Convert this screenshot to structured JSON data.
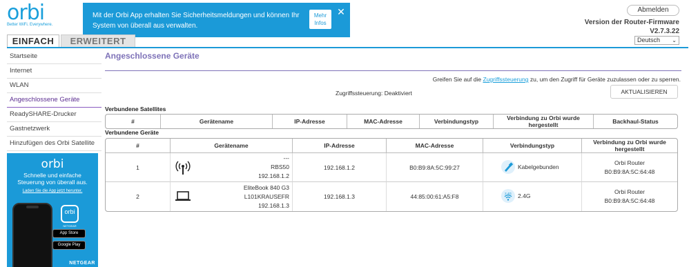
{
  "header": {
    "logo_word": "orbi",
    "logo_tagline": "Better WiFi. Everywhere.",
    "banner_text": "Mit der Orbi App erhalten Sie Sicherheitsmeldungen und können Ihr System von überall aus verwalten.",
    "banner_more_label_1": "Mehr",
    "banner_more_label_2": "Infos",
    "banner_close": "✕",
    "tab_simple": "EINFACH",
    "tab_advanced": "ERWEITERT",
    "logout_label": "Abmelden",
    "firmware_label": "Version der Router-Firmware",
    "firmware_version": "V2.7.3.22",
    "language": "Deutsch",
    "language_arrow": "⌄",
    "accent_color": "#1b9ad8"
  },
  "sidebar": {
    "items": [
      {
        "label": "Startseite"
      },
      {
        "label": "Internet"
      },
      {
        "label": "WLAN"
      },
      {
        "label": "Angeschlossene Geräte",
        "active": true
      },
      {
        "label": "ReadySHARE-Drucker"
      },
      {
        "label": "Gastnetzwerk"
      },
      {
        "label": "Hinzufügen des Orbi Satellite"
      }
    ],
    "promo": {
      "logo": "orbi",
      "text": "Schnelle und einfache Steuerung von überall aus.",
      "link": "Laden Sie die App jetzt herunter.",
      "app_icon_label": "orbi",
      "app_icon_sub": "NETGEAR",
      "app_store": "App Store",
      "google_play": "Google Play",
      "brand": "NETGEAR"
    }
  },
  "main": {
    "title": "Angeschlossene Geräte",
    "access_hint_prefix": "Greifen Sie auf die",
    "access_hint_link": "Zugriffssteuerung",
    "access_hint_suffix": "zu, um den Zugriff für Geräte zuzulassen oder zu sperren.",
    "access_status": "Zugriffssteuerung: Deaktiviert",
    "refresh_label": "AKTUALISIEREN",
    "satellites_label": "Verbundene Satellites",
    "satellite_columns": [
      "#",
      "Gerätename",
      "IP-Adresse",
      "MAC-Adresse",
      "Verbindungstyp",
      "Verbindung zu Orbi wurde hergestellt",
      "Backhaul-Status"
    ],
    "devices_label": "Verbundene Geräte",
    "device_columns": [
      "#",
      "Gerätename",
      "IP-Adresse",
      "MAC-Adresse",
      "Verbindungstyp",
      "Verbindung zu Orbi wurde hergestellt"
    ],
    "devices": [
      {
        "num": "1",
        "name_line1": "---",
        "name_line2": "RBS50",
        "name_line3": "192.168.1.2",
        "icon": "satellite-icon",
        "ip": "192.168.1.2",
        "mac": "B0:B9:8A:5C:99:27",
        "conn_icon": "ethernet-icon",
        "conn": "Kabelgebunden",
        "via_line1": "Orbi Router",
        "via_line2": "B0:B9:8A:5C:64:48"
      },
      {
        "num": "2",
        "name_line1": "EliteBook 840 G3",
        "name_line2": "L101KRAUSEFR",
        "name_line3": "192.168.1.3",
        "icon": "laptop-icon",
        "ip": "192.168.1.3",
        "mac": "44:85:00:61:A5:F8",
        "conn_icon": "wifi-2g-icon",
        "conn_badge": "2.4G",
        "conn": "2.4G",
        "via_line1": "Orbi Router",
        "via_line2": "B0:B9:8A:5C:64:48"
      }
    ]
  }
}
